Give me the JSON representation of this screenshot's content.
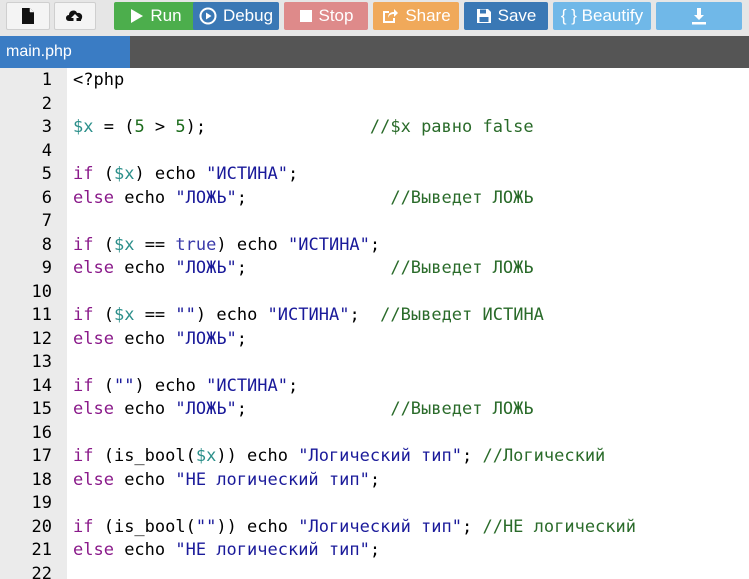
{
  "toolbar": {
    "run_label": "Run",
    "debug_label": "Debug",
    "stop_label": "Stop",
    "share_label": "Share",
    "save_label": "Save",
    "beautify_label": "{ } Beautify",
    "icons": {
      "new_file": "file-icon",
      "upload": "cloud-upload-icon",
      "run": "play-icon",
      "debug": "debug-circle-icon",
      "stop": "stop-square-icon",
      "share": "share-icon",
      "save": "floppy-disk-icon",
      "download": "download-icon"
    },
    "colors": {
      "run": "#4cae4c",
      "debug": "#3a78b5",
      "stop": "#de8a8a",
      "share": "#f0a95a",
      "save": "#3a78b5",
      "beautify": "#70b8e8",
      "download": "#70b8e8"
    }
  },
  "tab": {
    "label": "main.php",
    "color": "#3a7cc4"
  },
  "editor": {
    "lines": [
      {
        "n": "1",
        "tokens": [
          {
            "t": "<?php",
            "c": "plain"
          }
        ]
      },
      {
        "n": "2",
        "tokens": []
      },
      {
        "n": "3",
        "tokens": [
          {
            "t": "$x",
            "c": "var"
          },
          {
            "t": " = (",
            "c": "plain"
          },
          {
            "t": "5",
            "c": "num"
          },
          {
            "t": " > ",
            "c": "plain"
          },
          {
            "t": "5",
            "c": "num"
          },
          {
            "t": ");",
            "c": "plain"
          },
          {
            "t": "                //$x равно false",
            "c": "comment"
          }
        ]
      },
      {
        "n": "4",
        "tokens": []
      },
      {
        "n": "5",
        "tokens": [
          {
            "t": "if",
            "c": "kw"
          },
          {
            "t": " (",
            "c": "plain"
          },
          {
            "t": "$x",
            "c": "var"
          },
          {
            "t": ") echo ",
            "c": "plain"
          },
          {
            "t": "\"ИСТИНА\"",
            "c": "str"
          },
          {
            "t": ";",
            "c": "plain"
          }
        ]
      },
      {
        "n": "6",
        "tokens": [
          {
            "t": "else",
            "c": "kw"
          },
          {
            "t": " echo ",
            "c": "plain"
          },
          {
            "t": "\"ЛОЖЬ\"",
            "c": "str"
          },
          {
            "t": ";",
            "c": "plain"
          },
          {
            "t": "              //Выведет ЛОЖЬ",
            "c": "comment"
          }
        ]
      },
      {
        "n": "7",
        "tokens": []
      },
      {
        "n": "8",
        "tokens": [
          {
            "t": "if",
            "c": "kw"
          },
          {
            "t": " (",
            "c": "plain"
          },
          {
            "t": "$x",
            "c": "var"
          },
          {
            "t": " == ",
            "c": "plain"
          },
          {
            "t": "true",
            "c": "const"
          },
          {
            "t": ") echo ",
            "c": "plain"
          },
          {
            "t": "\"ИСТИНА\"",
            "c": "str"
          },
          {
            "t": ";",
            "c": "plain"
          }
        ]
      },
      {
        "n": "9",
        "tokens": [
          {
            "t": "else",
            "c": "kw"
          },
          {
            "t": " echo ",
            "c": "plain"
          },
          {
            "t": "\"ЛОЖЬ\"",
            "c": "str"
          },
          {
            "t": ";",
            "c": "plain"
          },
          {
            "t": "              //Выведет ЛОЖЬ",
            "c": "comment"
          }
        ]
      },
      {
        "n": "10",
        "tokens": []
      },
      {
        "n": "11",
        "tokens": [
          {
            "t": "if",
            "c": "kw"
          },
          {
            "t": " (",
            "c": "plain"
          },
          {
            "t": "$x",
            "c": "var"
          },
          {
            "t": " == ",
            "c": "plain"
          },
          {
            "t": "\"\"",
            "c": "str"
          },
          {
            "t": ") echo ",
            "c": "plain"
          },
          {
            "t": "\"ИСТИНА\"",
            "c": "str"
          },
          {
            "t": ";",
            "c": "plain"
          },
          {
            "t": "  //Выведет ИСТИНА",
            "c": "comment"
          }
        ]
      },
      {
        "n": "12",
        "tokens": [
          {
            "t": "else",
            "c": "kw"
          },
          {
            "t": " echo ",
            "c": "plain"
          },
          {
            "t": "\"ЛОЖЬ\"",
            "c": "str"
          },
          {
            "t": ";",
            "c": "plain"
          }
        ]
      },
      {
        "n": "13",
        "tokens": []
      },
      {
        "n": "14",
        "tokens": [
          {
            "t": "if",
            "c": "kw"
          },
          {
            "t": " (",
            "c": "plain"
          },
          {
            "t": "\"\"",
            "c": "str"
          },
          {
            "t": ") echo ",
            "c": "plain"
          },
          {
            "t": "\"ИСТИНА\"",
            "c": "str"
          },
          {
            "t": ";",
            "c": "plain"
          }
        ]
      },
      {
        "n": "15",
        "tokens": [
          {
            "t": "else",
            "c": "kw"
          },
          {
            "t": " echo ",
            "c": "plain"
          },
          {
            "t": "\"ЛОЖЬ\"",
            "c": "str"
          },
          {
            "t": ";",
            "c": "plain"
          },
          {
            "t": "              //Выведет ЛОЖЬ",
            "c": "comment"
          }
        ]
      },
      {
        "n": "16",
        "tokens": []
      },
      {
        "n": "17",
        "tokens": [
          {
            "t": "if",
            "c": "kw"
          },
          {
            "t": " (is_bool(",
            "c": "plain"
          },
          {
            "t": "$x",
            "c": "var"
          },
          {
            "t": ")) echo ",
            "c": "plain"
          },
          {
            "t": "\"Логический тип\"",
            "c": "str"
          },
          {
            "t": ";",
            "c": "plain"
          },
          {
            "t": " //Логический",
            "c": "comment"
          }
        ]
      },
      {
        "n": "18",
        "tokens": [
          {
            "t": "else",
            "c": "kw"
          },
          {
            "t": " echo ",
            "c": "plain"
          },
          {
            "t": "\"НЕ логический тип\"",
            "c": "str"
          },
          {
            "t": ";",
            "c": "plain"
          }
        ]
      },
      {
        "n": "19",
        "tokens": []
      },
      {
        "n": "20",
        "tokens": [
          {
            "t": "if",
            "c": "kw"
          },
          {
            "t": " (is_bool(",
            "c": "plain"
          },
          {
            "t": "\"\"",
            "c": "str"
          },
          {
            "t": ")) echo ",
            "c": "plain"
          },
          {
            "t": "\"Логический тип\"",
            "c": "str"
          },
          {
            "t": ";",
            "c": "plain"
          },
          {
            "t": " //НЕ логический",
            "c": "comment"
          }
        ]
      },
      {
        "n": "21",
        "tokens": [
          {
            "t": "else",
            "c": "kw"
          },
          {
            "t": " echo ",
            "c": "plain"
          },
          {
            "t": "\"НЕ логический тип\"",
            "c": "str"
          },
          {
            "t": ";",
            "c": "plain"
          }
        ]
      },
      {
        "n": "22",
        "tokens": []
      }
    ]
  }
}
